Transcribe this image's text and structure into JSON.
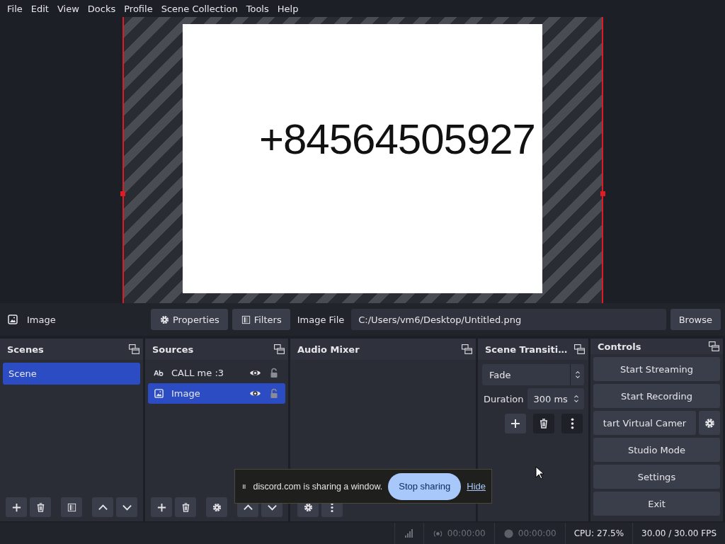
{
  "menu": [
    "File",
    "Edit",
    "View",
    "Docks",
    "Profile",
    "Scene Collection",
    "Tools",
    "Help"
  ],
  "preview": {
    "text": "+84564505927"
  },
  "source_toolbar": {
    "source_name": "Image",
    "buttons": [
      {
        "label": "Properties",
        "kind": "gear"
      },
      {
        "label": "Filters",
        "kind": "filter"
      }
    ],
    "field_label": "Image File",
    "field_value": "C:/Users/vm6/Desktop/Untitled.png",
    "browse": "Browse"
  },
  "scenes": {
    "title": "Scenes",
    "items": [
      {
        "label": "Scene",
        "selected": true
      }
    ],
    "tools": [
      {
        "kind": "plus"
      },
      {
        "kind": "trash"
      },
      {
        "kind": "filter"
      },
      {
        "kind": "up"
      },
      {
        "kind": "down"
      }
    ]
  },
  "sources": {
    "title": "Sources",
    "items": [
      {
        "label": "CALL me :3",
        "kind": "text",
        "selected": false,
        "visible": true,
        "locked": false
      },
      {
        "label": "Image",
        "kind": "image",
        "selected": true,
        "visible": true,
        "locked": false
      }
    ],
    "tools": [
      {
        "kind": "plus"
      },
      {
        "kind": "trash"
      },
      {
        "kind": "gear"
      },
      {
        "kind": "up"
      },
      {
        "kind": "down"
      }
    ]
  },
  "audio_mixer": {
    "title": "Audio Mixer",
    "tools": [
      {
        "kind": "gear"
      },
      {
        "kind": "dots"
      }
    ]
  },
  "transitions": {
    "title": "Scene Transiti…",
    "select": "Fade",
    "duration_label": "Duration",
    "duration_value": "300 ms",
    "tools": [
      {
        "kind": "plus"
      },
      {
        "kind": "trash"
      },
      {
        "kind": "dots"
      }
    ]
  },
  "controls": {
    "title": "Controls",
    "buttons": [
      {
        "label": "Start Streaming",
        "kind": "plain"
      },
      {
        "label": "Start Recording",
        "kind": "plain"
      },
      {
        "label": "tart Virtual Camer",
        "kind": "with_gear"
      },
      {
        "label": "Studio Mode",
        "kind": "plain"
      },
      {
        "label": "Settings",
        "kind": "plain"
      },
      {
        "label": "Exit",
        "kind": "plain"
      }
    ]
  },
  "share_bar": {
    "message": "discord.com is sharing a window.",
    "stop": "Stop sharing",
    "hide": "Hide"
  },
  "status_bar": {
    "stream_time": "00:00:00",
    "record_time": "00:00:00",
    "cpu": "CPU: 27.5%",
    "fps": "30.00 / 30.00 FPS"
  }
}
